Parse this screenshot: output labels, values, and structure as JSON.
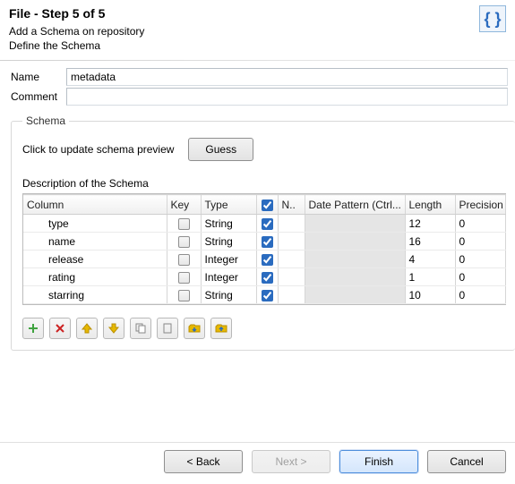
{
  "header": {
    "title": "File - Step 5 of 5",
    "line1": "Add a Schema on repository",
    "line2": "Define the Schema",
    "banner_glyph": "{ }"
  },
  "form": {
    "name_label": "Name",
    "name_value": "metadata",
    "comment_label": "Comment",
    "comment_value": ""
  },
  "schema": {
    "group_title": "Schema",
    "update_hint": "Click to update schema preview",
    "guess_label": "Guess",
    "desc_label": "Description of the Schema",
    "headers": {
      "column": "Column",
      "key": "Key",
      "type": "Type",
      "nullable_short": "N..",
      "date_pattern": "Date Pattern (Ctrl...",
      "length": "Length",
      "precision": "Precision"
    },
    "rows": [
      {
        "column": "type",
        "key": false,
        "type": "String",
        "nullable": true,
        "date_pattern": "",
        "length": "12",
        "precision": "0"
      },
      {
        "column": "name",
        "key": false,
        "type": "String",
        "nullable": true,
        "date_pattern": "",
        "length": "16",
        "precision": "0"
      },
      {
        "column": "release",
        "key": false,
        "type": "Integer",
        "nullable": true,
        "date_pattern": "",
        "length": "4",
        "precision": "0"
      },
      {
        "column": "rating",
        "key": false,
        "type": "Integer",
        "nullable": true,
        "date_pattern": "",
        "length": "1",
        "precision": "0"
      },
      {
        "column": "starring",
        "key": false,
        "type": "String",
        "nullable": true,
        "date_pattern": "",
        "length": "10",
        "precision": "0"
      }
    ]
  },
  "toolbar": {
    "icons": [
      "add-icon",
      "remove-icon",
      "up-icon",
      "down-icon",
      "copy-icon",
      "paste-icon",
      "import-icon",
      "export-icon"
    ]
  },
  "footer": {
    "back": "< Back",
    "next": "Next >",
    "finish": "Finish",
    "cancel": "Cancel"
  }
}
